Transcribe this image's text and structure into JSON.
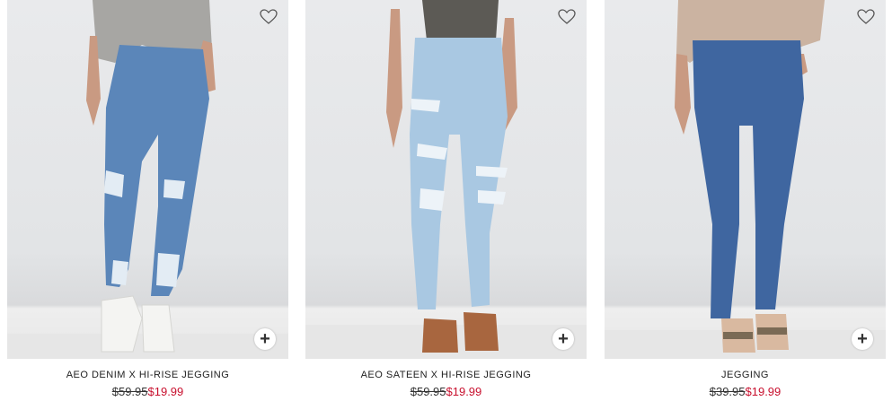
{
  "products": [
    {
      "name": "AEO DENIM X HI-RISE JEGGING",
      "was_price": "$59.95",
      "sale_price": "$19.99",
      "favorite_icon": "heart-outline-icon",
      "add_icon": "plus-icon",
      "colors": {
        "denim": "#5b86b9",
        "top": "#a7a6a3",
        "shoes": "#f4f4f2",
        "skin": "#c99a82"
      }
    },
    {
      "name": "AEO SATEEN X HI-RISE JEGGING",
      "was_price": "$59.95",
      "sale_price": "$19.99",
      "favorite_icon": "heart-outline-icon",
      "add_icon": "plus-icon",
      "colors": {
        "denim": "#a9c8e2",
        "top": "#5c5a55",
        "shoes": "#a8663f",
        "skin": "#c99a82"
      }
    },
    {
      "name": "JEGGING",
      "was_price": "$39.95",
      "sale_price": "$19.99",
      "favorite_icon": "heart-outline-icon",
      "add_icon": "plus-icon",
      "colors": {
        "denim": "#3f66a0",
        "top": "#cbb3a1",
        "shoes": "#7a6a55",
        "skin": "#c99a82"
      }
    }
  ],
  "add_symbol": "+",
  "price_colors": {
    "sale": "#c8102e",
    "was": "#333333"
  }
}
